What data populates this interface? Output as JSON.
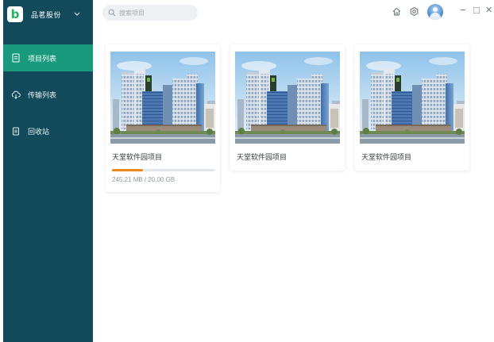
{
  "app": {
    "name": "品茗股份",
    "logo_letter": "b",
    "brand_color": "#1fb45e"
  },
  "sidebar": {
    "background": "#124a5c",
    "active_color": "#1a9a7c",
    "items": [
      {
        "label": "项目列表",
        "icon": "document-icon",
        "active": true
      },
      {
        "label": "传输列表",
        "icon": "cloud-transfer-icon",
        "active": false
      },
      {
        "label": "回收站",
        "icon": "trash-icon",
        "active": false
      }
    ]
  },
  "search": {
    "placeholder": "搜索项目"
  },
  "toolbar": {
    "icons": [
      "home-icon",
      "settings-icon",
      "avatar",
      "minimize-icon",
      "maximize-icon",
      "close-icon"
    ],
    "minimize_glyph": "−",
    "maximize_glyph": "□",
    "close_glyph": "✕"
  },
  "projects": [
    {
      "title": "天堂软件园项目",
      "size_text": "245.21 MB / 20.00 GB",
      "progress": 0.3
    },
    {
      "title": "天堂软件园项目"
    },
    {
      "title": "天堂软件园项目"
    }
  ],
  "colors": {
    "progress": "#f28a1a"
  }
}
